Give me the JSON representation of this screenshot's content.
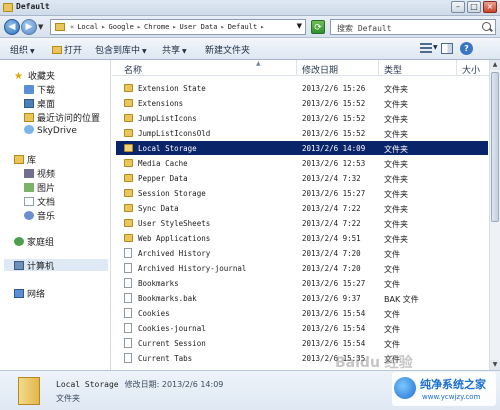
{
  "window": {
    "title": "Default"
  },
  "address": {
    "crumbs": [
      "Local",
      "Google",
      "Chrome",
      "User Data",
      "Default"
    ],
    "search_placeholder": "搜索 Default"
  },
  "toolbar": {
    "organize": "组织",
    "open": "打开",
    "include_library": "包含到库中",
    "share": "共享",
    "new_folder": "新建文件夹"
  },
  "nav": {
    "favorites": "收藏夹",
    "downloads": "下载",
    "desktop": "桌面",
    "recent": "最近访问的位置",
    "skydrive": "SkyDrive",
    "libraries": "库",
    "videos": "视频",
    "pictures": "图片",
    "documents": "文档",
    "music": "音乐",
    "homegroup": "家庭组",
    "computer": "计算机",
    "network": "网络"
  },
  "columns": {
    "name": "名称",
    "date": "修改日期",
    "type": "类型",
    "size": "大小"
  },
  "files": [
    {
      "name": "Extension State",
      "date": "2013/2/6 15:26",
      "type": "文件夹",
      "kind": "folder"
    },
    {
      "name": "Extensions",
      "date": "2013/2/6 15:52",
      "type": "文件夹",
      "kind": "folder"
    },
    {
      "name": "JumpListIcons",
      "date": "2013/2/6 15:52",
      "type": "文件夹",
      "kind": "folder"
    },
    {
      "name": "JumpListIconsOld",
      "date": "2013/2/6 15:52",
      "type": "文件夹",
      "kind": "folder"
    },
    {
      "name": "Local Storage",
      "date": "2013/2/6 14:09",
      "type": "文件夹",
      "kind": "folder",
      "selected": true
    },
    {
      "name": "Media Cache",
      "date": "2013/2/6 12:53",
      "type": "文件夹",
      "kind": "folder"
    },
    {
      "name": "Pepper Data",
      "date": "2013/2/4 7:32",
      "type": "文件夹",
      "kind": "folder"
    },
    {
      "name": "Session Storage",
      "date": "2013/2/6 15:27",
      "type": "文件夹",
      "kind": "folder"
    },
    {
      "name": "Sync Data",
      "date": "2013/2/4 7:22",
      "type": "文件夹",
      "kind": "folder"
    },
    {
      "name": "User StyleSheets",
      "date": "2013/2/4 7:22",
      "type": "文件夹",
      "kind": "folder"
    },
    {
      "name": "Web Applications",
      "date": "2013/2/4 9:51",
      "type": "文件夹",
      "kind": "folder"
    },
    {
      "name": "Archived History",
      "date": "2013/2/4 7:20",
      "type": "文件",
      "kind": "file"
    },
    {
      "name": "Archived History-journal",
      "date": "2013/2/4 7:20",
      "type": "文件",
      "kind": "file"
    },
    {
      "name": "Bookmarks",
      "date": "2013/2/6 15:27",
      "type": "文件",
      "kind": "file"
    },
    {
      "name": "Bookmarks.bak",
      "date": "2013/2/6 9:37",
      "type": "BAK 文件",
      "kind": "file"
    },
    {
      "name": "Cookies",
      "date": "2013/2/6 15:54",
      "type": "文件",
      "kind": "file"
    },
    {
      "name": "Cookies-journal",
      "date": "2013/2/6 15:54",
      "type": "文件",
      "kind": "file"
    },
    {
      "name": "Current Session",
      "date": "2013/2/6 15:54",
      "type": "文件",
      "kind": "file"
    },
    {
      "name": "Current Tabs",
      "date": "2013/2/6 15:35",
      "type": "文件",
      "kind": "file"
    }
  ],
  "details": {
    "name": "Local Storage",
    "date_label": "修改日期: 2013/2/6 14:09",
    "type": "文件夹"
  },
  "watermark": {
    "baidu": "Baidu 经验",
    "brand": "纯净系统之家",
    "url": "www.ycwjzy.com"
  }
}
